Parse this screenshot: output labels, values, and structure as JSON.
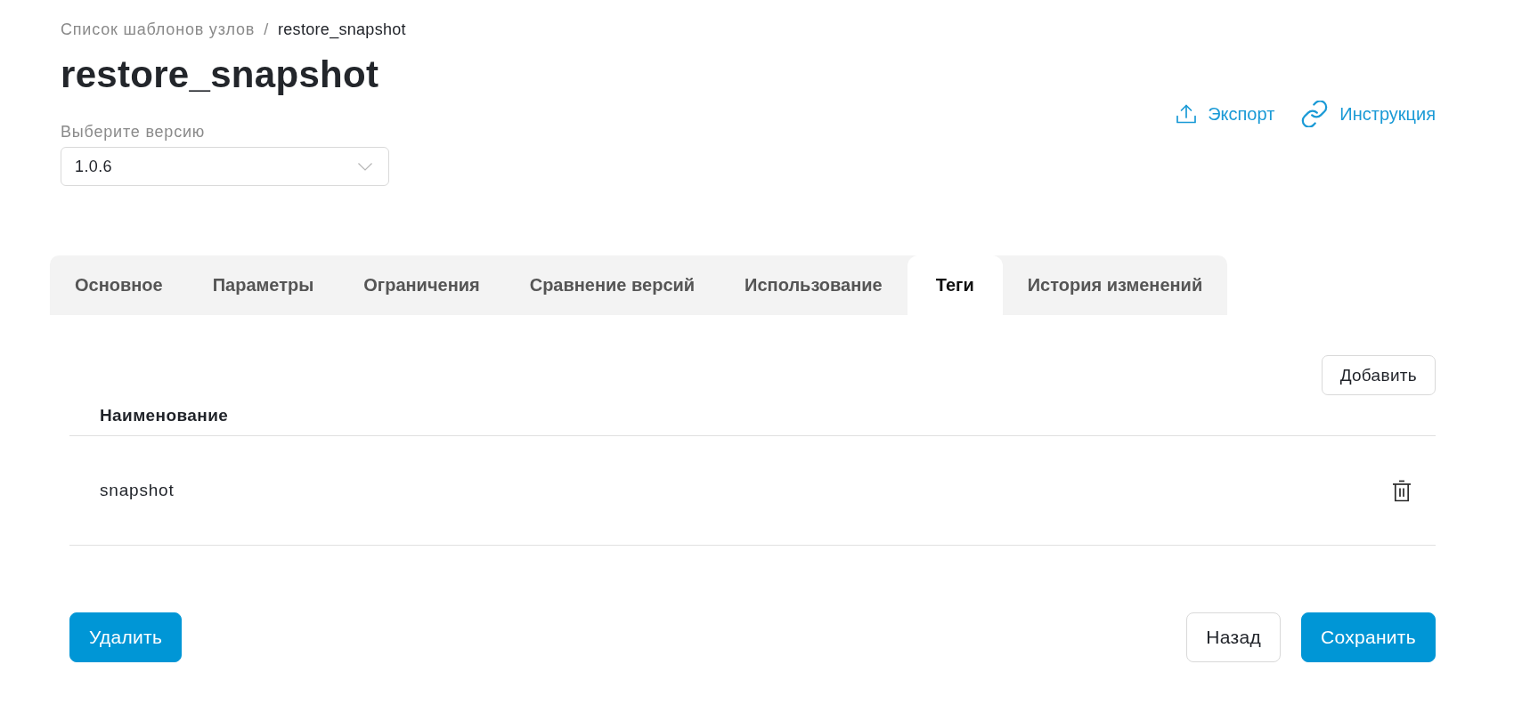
{
  "breadcrumb": {
    "separator": "/",
    "items": [
      {
        "label": "Список шаблонов узлов",
        "current": false
      },
      {
        "label": "restore_snapshot",
        "current": true
      }
    ]
  },
  "title": "restore_snapshot",
  "version_select": {
    "label": "Выберите версию",
    "value": "1.0.6"
  },
  "actions": [
    {
      "label": "Экспорт",
      "kind": "upload"
    },
    {
      "label": "Инструкция",
      "kind": "link"
    }
  ],
  "tabs": [
    {
      "label": "Основное",
      "selected": false
    },
    {
      "label": "Параметры",
      "selected": false
    },
    {
      "label": "Ограничения",
      "selected": false
    },
    {
      "label": "Сравнение версий",
      "selected": false
    },
    {
      "label": "Использование",
      "selected": false
    },
    {
      "label": "Теги",
      "selected": true
    },
    {
      "label": "История изменений",
      "selected": false
    }
  ],
  "tags_table": {
    "add_button": "Добавить",
    "columns": [
      "Наименование"
    ],
    "rows": [
      {
        "name": "snapshot"
      }
    ]
  },
  "footer": {
    "left": [
      {
        "label": "Удалить",
        "kind": "primary"
      }
    ],
    "right": [
      {
        "label": "Назад",
        "kind": "secondary"
      },
      {
        "label": "Сохранить",
        "kind": "primary"
      }
    ]
  }
}
